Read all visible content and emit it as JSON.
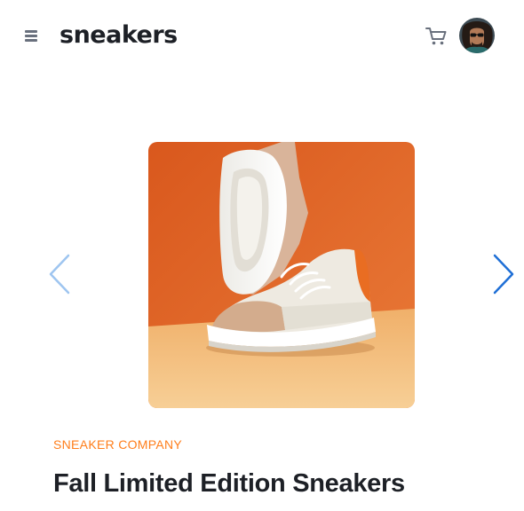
{
  "header": {
    "logo": "sneakers",
    "menu_icon": "menu-icon",
    "cart_icon": "cart-icon",
    "avatar_icon": "avatar"
  },
  "gallery": {
    "prev_icon": "chevron-left-icon",
    "next_icon": "chevron-right-icon"
  },
  "product": {
    "company": "SNEAKER COMPANY",
    "title": "Fall Limited Edition Sneakers"
  },
  "colors": {
    "accent": "#ff7e1b",
    "text_dark": "#1d2026",
    "icon_gray": "#69707d",
    "arrow_light_blue": "#9ec5f0",
    "arrow_blue": "#1f6fd6"
  }
}
